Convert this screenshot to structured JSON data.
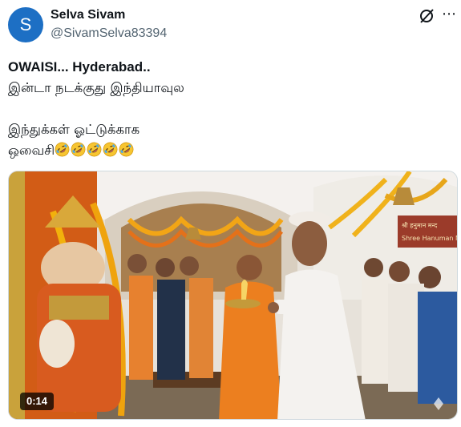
{
  "author": {
    "avatar_letter": "S",
    "display_name": "Selva Sivam",
    "handle": "@SivamSelva83394",
    "avatar_color": "#1d6fc4"
  },
  "actions": {
    "grok_icon": "grok-icon",
    "more_icon": "more-horizontal-icon"
  },
  "post": {
    "line1": "OWAISI... Hyderabad..",
    "line2": "இன்டா நடக்குது இந்தியாவுல",
    "line3": "இந்துக்கள் ஓட்டுக்காக",
    "line4": "ஒவைசி",
    "emoji_name": "rolling-on-floor-laughing-emoji",
    "emoji_count": 5
  },
  "media": {
    "duration": "0:14",
    "sign_line1": "श्री हनुमान मन्द",
    "sign_line2": "Shree Hanuman Mandir"
  }
}
